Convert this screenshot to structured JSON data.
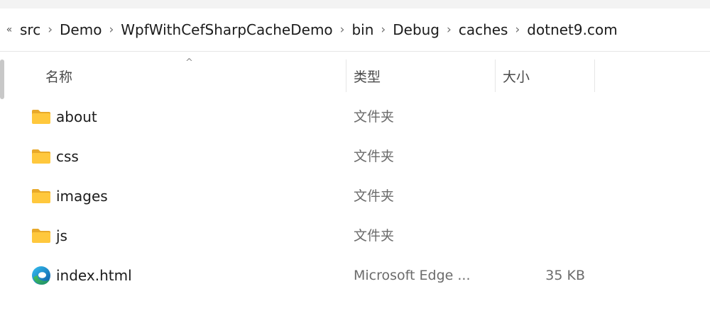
{
  "breadcrumb": {
    "overflow": "«",
    "items": [
      "src",
      "Demo",
      "WpfWithCefSharpCacheDemo",
      "bin",
      "Debug",
      "caches",
      "dotnet9.com"
    ],
    "separator": "›"
  },
  "columns": {
    "name": "名称",
    "type": "类型",
    "size": "大小",
    "sort_indicator": "^"
  },
  "files": [
    {
      "name": "about",
      "type": "文件夹",
      "size": "",
      "icon": "folder-icon"
    },
    {
      "name": "css",
      "type": "文件夹",
      "size": "",
      "icon": "folder-icon"
    },
    {
      "name": "images",
      "type": "文件夹",
      "size": "",
      "icon": "folder-icon"
    },
    {
      "name": "js",
      "type": "文件夹",
      "size": "",
      "icon": "folder-icon"
    },
    {
      "name": "index.html",
      "type": "Microsoft Edge ...",
      "size": "35 KB",
      "icon": "edge-html-icon"
    }
  ],
  "colors": {
    "folder_front": "#FFC83D",
    "folder_back": "#E8A92A",
    "edge_blue": "#0C59A4",
    "edge_green": "#45C05B"
  }
}
